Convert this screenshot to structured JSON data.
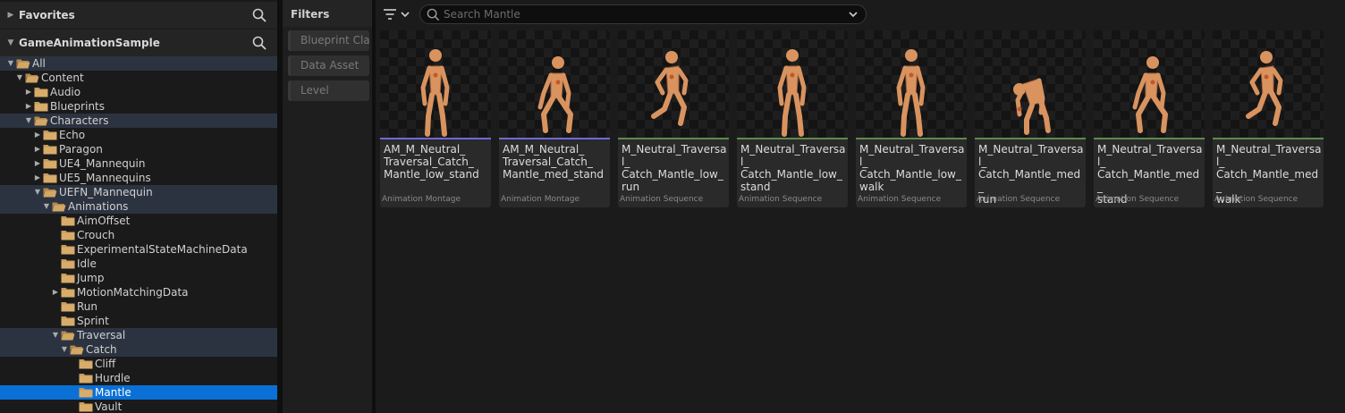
{
  "favorites": {
    "title": "Favorites"
  },
  "project": {
    "title": "GameAnimationSample"
  },
  "tree": [
    {
      "label": "All",
      "depth": 0,
      "expanded": true,
      "arrow": "down",
      "highlight": true
    },
    {
      "label": "Content",
      "depth": 1,
      "arrow": "down",
      "expanded": true
    },
    {
      "label": "Audio",
      "depth": 2,
      "arrow": "right"
    },
    {
      "label": "Blueprints",
      "depth": 2,
      "arrow": "right"
    },
    {
      "label": "Characters",
      "depth": 2,
      "arrow": "down",
      "expanded": true,
      "highlight": true
    },
    {
      "label": "Echo",
      "depth": 3,
      "arrow": "right"
    },
    {
      "label": "Paragon",
      "depth": 3,
      "arrow": "right"
    },
    {
      "label": "UE4_Mannequin",
      "depth": 3,
      "arrow": "right"
    },
    {
      "label": "UE5_Mannequins",
      "depth": 3,
      "arrow": "right"
    },
    {
      "label": "UEFN_Mannequin",
      "depth": 3,
      "arrow": "down",
      "expanded": true,
      "highlight": true
    },
    {
      "label": "Animations",
      "depth": 4,
      "arrow": "down",
      "expanded": true,
      "highlight": true
    },
    {
      "label": "AimOffset",
      "depth": 5,
      "arrow": ""
    },
    {
      "label": "Crouch",
      "depth": 5,
      "arrow": ""
    },
    {
      "label": "ExperimentalStateMachineData",
      "depth": 5,
      "arrow": ""
    },
    {
      "label": "Idle",
      "depth": 5,
      "arrow": ""
    },
    {
      "label": "Jump",
      "depth": 5,
      "arrow": ""
    },
    {
      "label": "MotionMatchingData",
      "depth": 5,
      "arrow": "right"
    },
    {
      "label": "Run",
      "depth": 5,
      "arrow": ""
    },
    {
      "label": "Sprint",
      "depth": 5,
      "arrow": ""
    },
    {
      "label": "Traversal",
      "depth": 5,
      "arrow": "down",
      "expanded": true,
      "highlight": true
    },
    {
      "label": "Catch",
      "depth": 6,
      "arrow": "down",
      "expanded": true,
      "highlight": true
    },
    {
      "label": "Cliff",
      "depth": 7,
      "arrow": ""
    },
    {
      "label": "Hurdle",
      "depth": 7,
      "arrow": ""
    },
    {
      "label": "Mantle",
      "depth": 7,
      "arrow": "",
      "selected": true
    },
    {
      "label": "Vault",
      "depth": 7,
      "arrow": ""
    }
  ],
  "filters": {
    "title": "Filters",
    "items": [
      "Blueprint Class",
      "Data Asset",
      "Level"
    ]
  },
  "search": {
    "placeholder": "Search Mantle",
    "value": ""
  },
  "colors": {
    "montage": "#6f6ad6",
    "sequence": "#5f8a4e",
    "selected": "#0a70d6",
    "folder": "#c89b5a"
  },
  "assets": [
    {
      "name": "AM_M_Neutral_Traversal_Catch_Mantle_low_stand",
      "lines": [
        "AM_M_Neutral_",
        "Traversal_Catch_",
        "Mantle_low_stand"
      ],
      "type": "Animation Montage",
      "kind": "montage",
      "pose": "stand"
    },
    {
      "name": "AM_M_Neutral_Traversal_Catch_Mantle_med_stand",
      "lines": [
        "AM_M_Neutral_",
        "Traversal_Catch_",
        "Mantle_med_stand"
      ],
      "type": "Animation Montage",
      "kind": "montage",
      "pose": "crouch"
    },
    {
      "name": "M_Neutral_Traversal_Catch_Mantle_low_run",
      "lines": [
        "M_Neutral_Traversal_",
        "Catch_Mantle_low_",
        "run"
      ],
      "type": "Animation Sequence",
      "kind": "sequence",
      "pose": "run"
    },
    {
      "name": "M_Neutral_Traversal_Catch_Mantle_low_stand",
      "lines": [
        "M_Neutral_Traversal_",
        "Catch_Mantle_low_",
        "stand"
      ],
      "type": "Animation Sequence",
      "kind": "sequence",
      "pose": "stand"
    },
    {
      "name": "M_Neutral_Traversal_Catch_Mantle_low_walk",
      "lines": [
        "M_Neutral_Traversal_",
        "Catch_Mantle_low_",
        "walk"
      ],
      "type": "Animation Sequence",
      "kind": "sequence",
      "pose": "stand"
    },
    {
      "name": "M_Neutral_Traversal_Catch_Mantle_med_run",
      "lines": [
        "M_Neutral_Traversal_",
        "Catch_Mantle_med_",
        "run"
      ],
      "type": "Animation Sequence",
      "kind": "sequence",
      "pose": "bend"
    },
    {
      "name": "M_Neutral_Traversal_Catch_Mantle_med_stand",
      "lines": [
        "M_Neutral_Traversal_",
        "Catch_Mantle_med_",
        "stand"
      ],
      "type": "Animation Sequence",
      "kind": "sequence",
      "pose": "crouch"
    },
    {
      "name": "M_Neutral_Traversal_Catch_Mantle_med_walk",
      "lines": [
        "M_Neutral_Traversal_",
        "Catch_Mantle_med_",
        "walk"
      ],
      "type": "Animation Sequence",
      "kind": "sequence",
      "pose": "run"
    }
  ],
  "icons": {
    "favorites_search": "search-icon",
    "project_search": "search-icon",
    "filter": "filter-icon",
    "search": "search-icon",
    "dropdown": "chevron-down-icon",
    "folder": "folder-icon"
  }
}
